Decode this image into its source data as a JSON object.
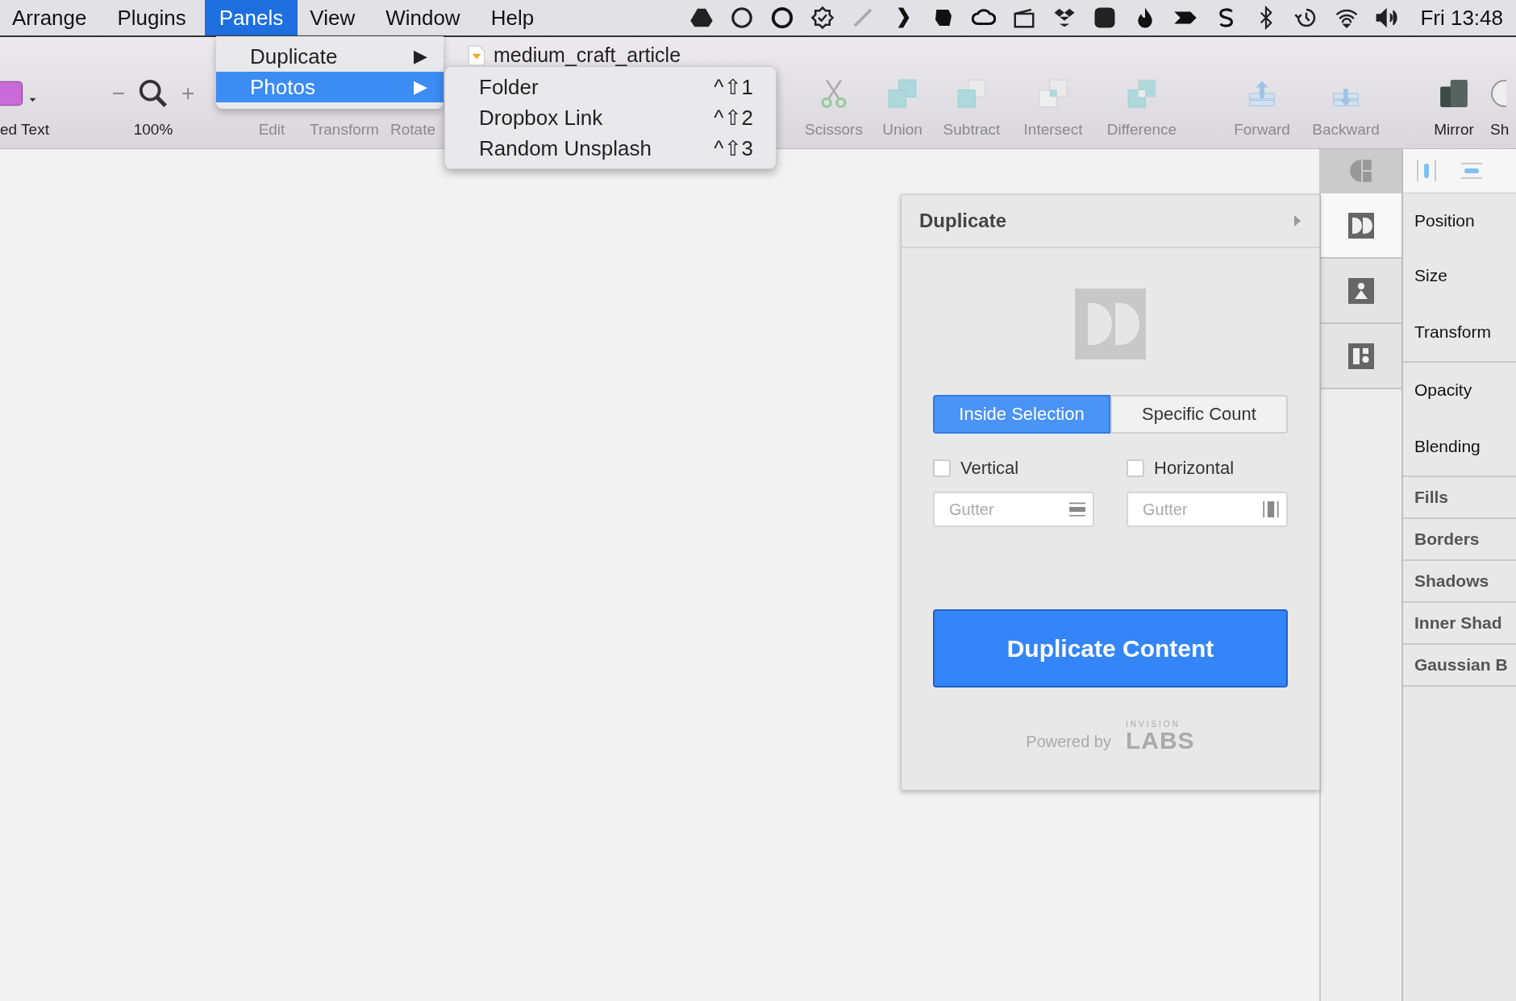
{
  "menu_bar": {
    "items": [
      {
        "label": "Arrange",
        "selected": false
      },
      {
        "label": "Plugins",
        "selected": false
      },
      {
        "label": "Panels",
        "selected": true
      },
      {
        "label": "View",
        "selected": false
      },
      {
        "label": "Window",
        "selected": false
      },
      {
        "label": "Help",
        "selected": false
      }
    ],
    "clock": "Fri 13:48"
  },
  "menu": {
    "items": [
      {
        "label": "Duplicate",
        "arrow": "▶",
        "selected": false
      },
      {
        "label": "Photos",
        "arrow": "▶",
        "selected": true
      }
    ],
    "submenu": [
      {
        "label": "Folder",
        "shortcut": "^⇧1"
      },
      {
        "label": "Dropbox Link",
        "shortcut": "^⇧2"
      },
      {
        "label": "Random Unsplash",
        "shortcut": "^⇧3"
      }
    ]
  },
  "document_title": "medium_craft_article",
  "toolbar": [
    {
      "kind": "text",
      "label": "ed Text",
      "disabled": false
    },
    {
      "kind": "zoom",
      "label": "100%",
      "minus": "−",
      "plus": "+",
      "disabled": false
    },
    {
      "kind": "edit",
      "label": "Edit",
      "disabled": true
    },
    {
      "kind": "transform",
      "label": "Transform",
      "disabled": true
    },
    {
      "kind": "rotate",
      "label": "Rotate",
      "disabled": true
    },
    {
      "kind": "scissors",
      "label": "Scissors",
      "disabled": true
    },
    {
      "kind": "union",
      "label": "Union",
      "disabled": true
    },
    {
      "kind": "subtract",
      "label": "Subtract",
      "disabled": true
    },
    {
      "kind": "intersect",
      "label": "Intersect",
      "disabled": true
    },
    {
      "kind": "difference",
      "label": "Difference",
      "disabled": true
    },
    {
      "kind": "forward",
      "label": "Forward",
      "disabled": true
    },
    {
      "kind": "backward",
      "label": "Backward",
      "disabled": true
    },
    {
      "kind": "mirror",
      "label": "Mirror",
      "disabled": false
    },
    {
      "kind": "share",
      "label": "Sh",
      "disabled": false
    }
  ],
  "panel": {
    "title": "Duplicate",
    "modes": [
      {
        "label": "Inside Selection",
        "selected": true
      },
      {
        "label": "Specific Count",
        "selected": false
      }
    ],
    "options": [
      {
        "label": "Vertical",
        "checked": false,
        "placeholder": "Gutter",
        "kind": "rows"
      },
      {
        "label": "Horizontal",
        "checked": false,
        "placeholder": "Gutter",
        "kind": "columns"
      }
    ],
    "action": "Duplicate Content",
    "footer": {
      "text": "Powered by",
      "brand_small": "INVISION",
      "brand_large": "LABS"
    }
  },
  "sidebar": {
    "toggle": {
      "on": true
    },
    "tabs": [
      {
        "kind": "duplicate",
        "selected": true
      },
      {
        "kind": "photo",
        "selected": false
      },
      {
        "kind": "layout",
        "selected": false
      }
    ]
  },
  "inspector": [
    {
      "label": "Position",
      "kind": "field",
      "divider": false
    },
    {
      "label": "Size",
      "kind": "field",
      "divider": false
    },
    {
      "label": "Transform",
      "kind": "field",
      "divider": true
    },
    {
      "label": "Opacity",
      "kind": "field",
      "divider": false
    },
    {
      "label": "Blending",
      "kind": "field",
      "divider": true
    },
    {
      "label": "Fills",
      "kind": "section",
      "divider": true
    },
    {
      "label": "Borders",
      "kind": "section",
      "divider": true
    },
    {
      "label": "Shadows",
      "kind": "section",
      "divider": true
    },
    {
      "label": "Inner Shad",
      "kind": "section",
      "divider": true
    },
    {
      "label": "Gaussian B",
      "kind": "section",
      "divider": true
    }
  ]
}
